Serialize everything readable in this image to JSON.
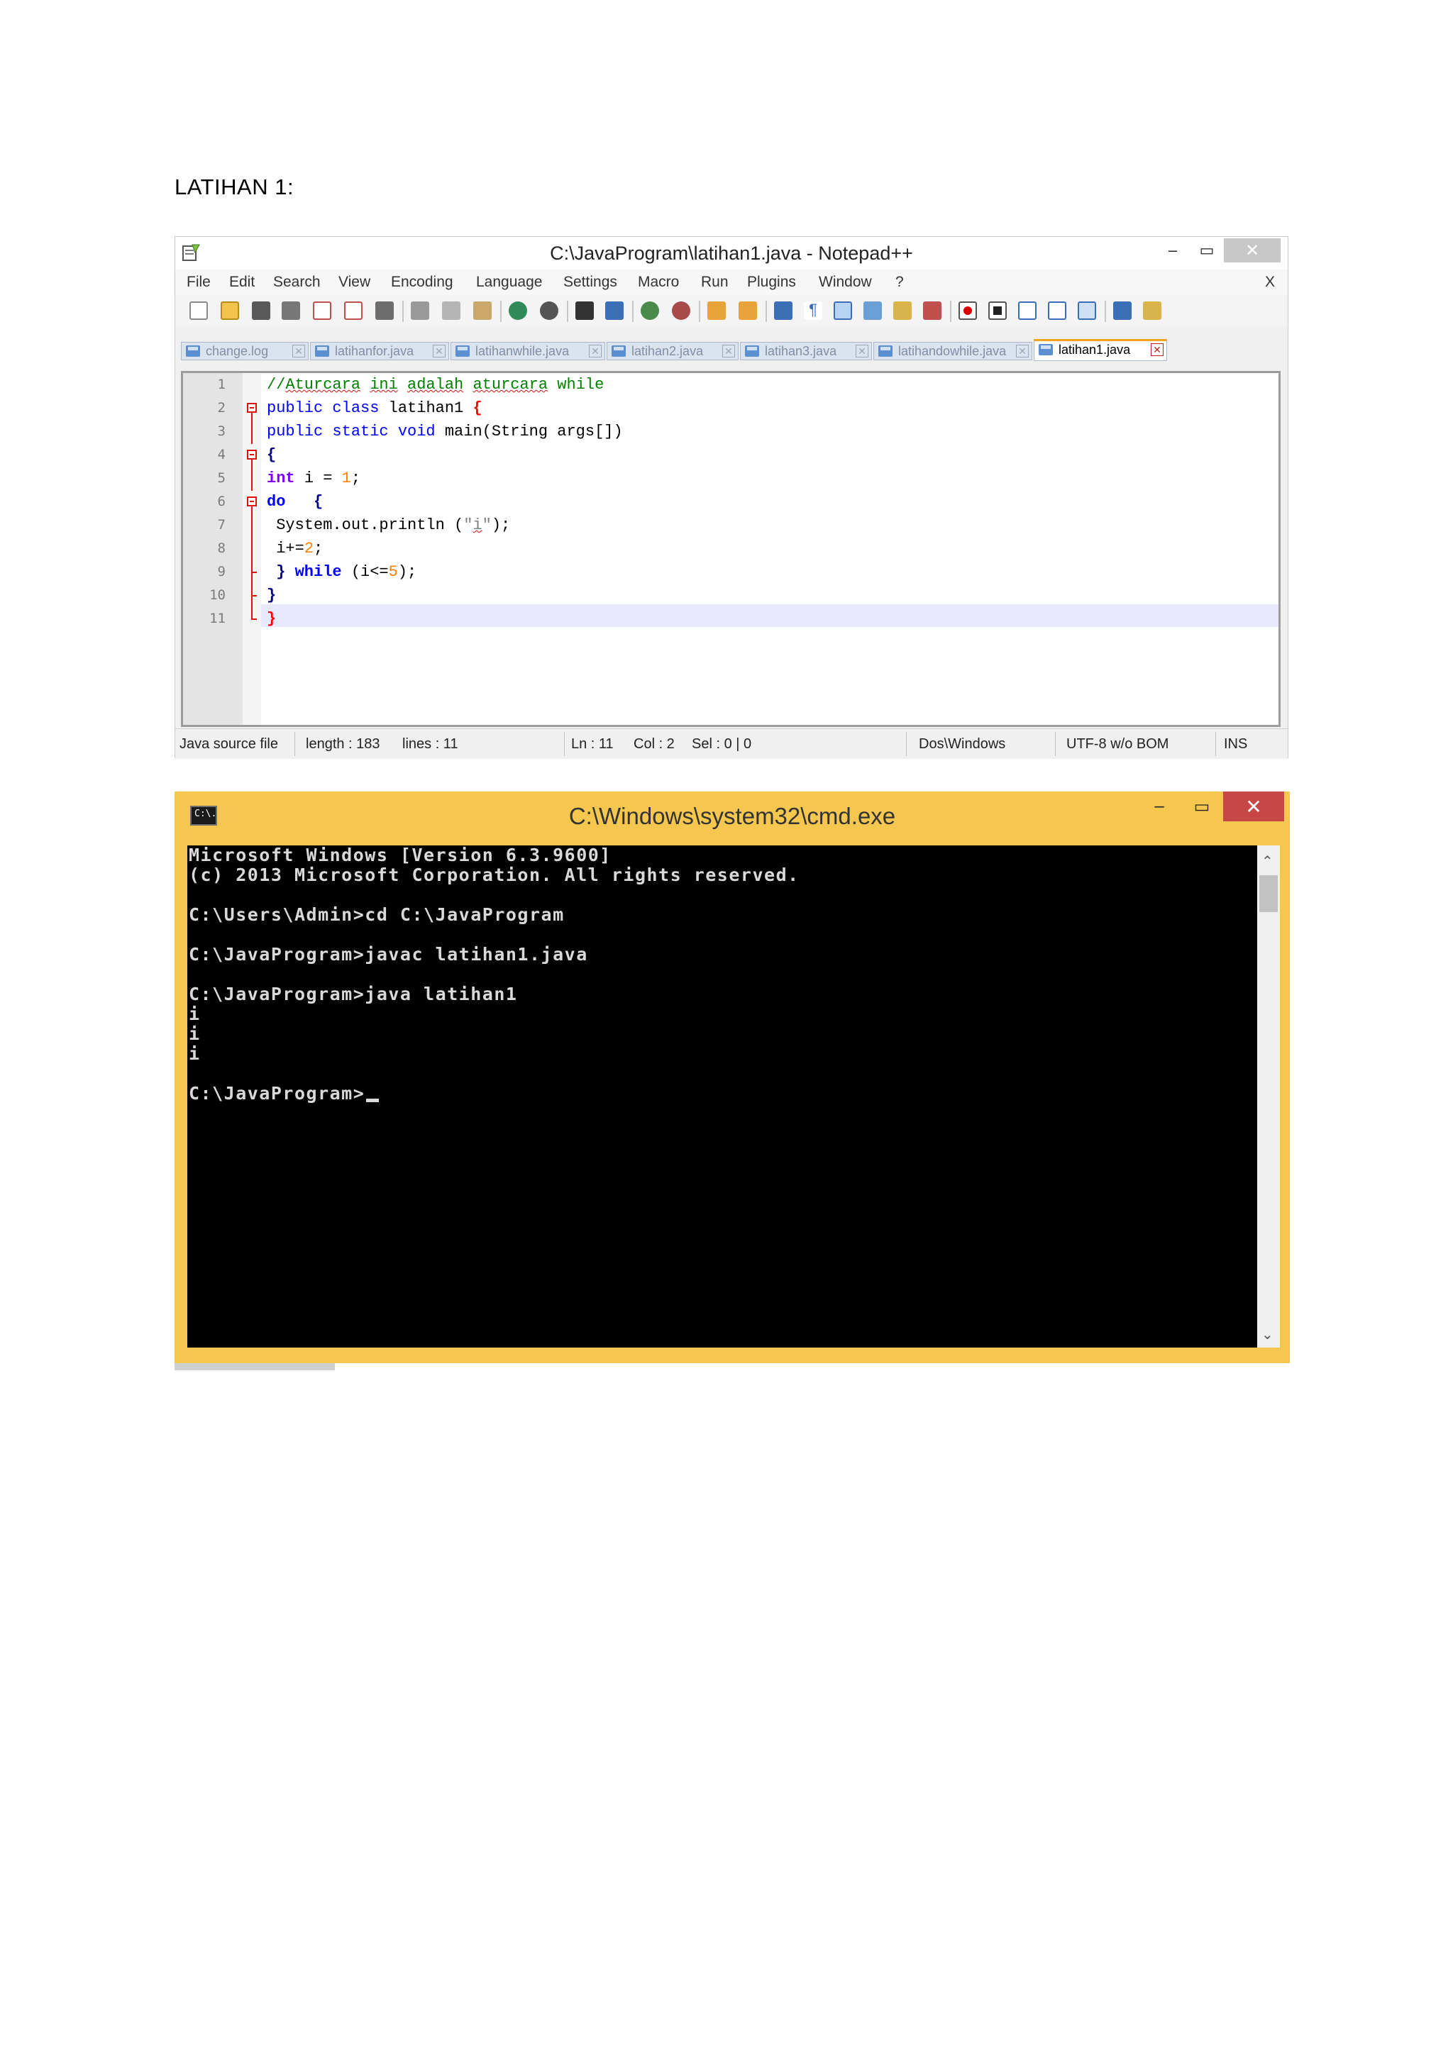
{
  "document": {
    "heading": "LATIHAN 1:"
  },
  "notepad": {
    "title": "C:\\JavaProgram\\latihan1.java - Notepad++",
    "window_buttons": {
      "minimize": "‒",
      "maximize": "▭",
      "close": "✕"
    },
    "menu": [
      "File",
      "Edit",
      "Search",
      "View",
      "Encoding",
      "Language",
      "Settings",
      "Macro",
      "Run",
      "Plugins",
      "Window",
      "?"
    ],
    "menu_close": "X",
    "tabs": [
      {
        "label": "change.log",
        "active": false
      },
      {
        "label": "latihanfor.java",
        "active": false
      },
      {
        "label": "latihanwhile.java",
        "active": false
      },
      {
        "label": "latihan2.java",
        "active": false
      },
      {
        "label": "latihan3.java",
        "active": false
      },
      {
        "label": "latihandowhile.java",
        "active": false
      },
      {
        "label": "latihan1.java",
        "active": true
      }
    ],
    "line_numbers": [
      "1",
      "2",
      "3",
      "4",
      "5",
      "6",
      "7",
      "8",
      "9",
      "10",
      "11"
    ],
    "code": {
      "l1_comment_prefix": "//",
      "l1_words": [
        "Aturcara",
        "ini",
        "adalah",
        "aturcara"
      ],
      "l1_tail": "while",
      "l2_kw": "public class",
      "l2_name": "latihan1",
      "l2_brace": "{",
      "l3_kw": "public static void",
      "l3_rest": "main(String args[])",
      "l4_brace": "{",
      "l5_kw": "int",
      "l5_mid": "i = ",
      "l5_num": "1",
      "l5_end": ";",
      "l6_kw": "do",
      "l6_brace": "{",
      "l7_pre": "System.out.println (",
      "l7_quote_open": "\"",
      "l7_char": "i",
      "l7_quote_close": "\"",
      "l7_end": ");",
      "l8_pre": "i+=",
      "l8_num": "2",
      "l8_end": ";",
      "l9_pre": "} ",
      "l9_kw": "while",
      "l9_mid": " (i<=",
      "l9_num": "5",
      "l9_end": ");",
      "l10_brace": "}",
      "l11_brace": "}"
    },
    "status": {
      "file_type": "Java source file",
      "length": "length : 183",
      "lines": "lines : 11",
      "ln": "Ln : 11",
      "col": "Col : 2",
      "sel": "Sel : 0 | 0",
      "eol": "Dos\\Windows",
      "encoding": "UTF-8 w/o BOM",
      "mode": "INS"
    }
  },
  "cmd": {
    "title": "C:\\Windows\\system32\\cmd.exe",
    "icon_label": "C:\\.",
    "window_buttons": {
      "minimize": "‒",
      "maximize": "▭",
      "close": "✕"
    },
    "lines": [
      "Microsoft Windows [Version 6.3.9600]",
      "(c) 2013 Microsoft Corporation. All rights reserved.",
      "",
      "C:\\Users\\Admin>cd C:\\JavaProgram",
      "",
      "C:\\JavaProgram>javac latihan1.java",
      "",
      "C:\\JavaProgram>java latihan1",
      "i",
      "i",
      "i",
      "",
      "C:\\JavaProgram>"
    ],
    "scroll": {
      "up": "⌃",
      "down": "⌄"
    }
  },
  "colors": {
    "cmd_frame": "#f5c74f",
    "cmd_close": "#c74646",
    "tab_active_accent": "#f6a21c",
    "keyword": "#0000ff",
    "comment": "#008000",
    "number": "#ff8000",
    "brace": "#ff0000"
  }
}
